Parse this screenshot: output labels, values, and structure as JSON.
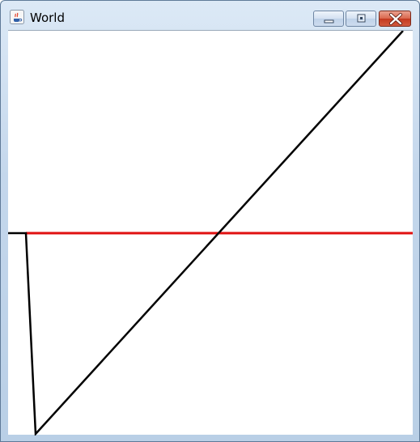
{
  "window": {
    "title": "World",
    "app_icon": "java-coffee-cup-icon",
    "controls": {
      "minimize": "minimize-icon",
      "maximize": "maximize-icon",
      "close": "close-icon"
    }
  },
  "colors": {
    "horizon_line": "#e01010",
    "path_line": "#000000",
    "close_button": "#c8402a"
  }
}
